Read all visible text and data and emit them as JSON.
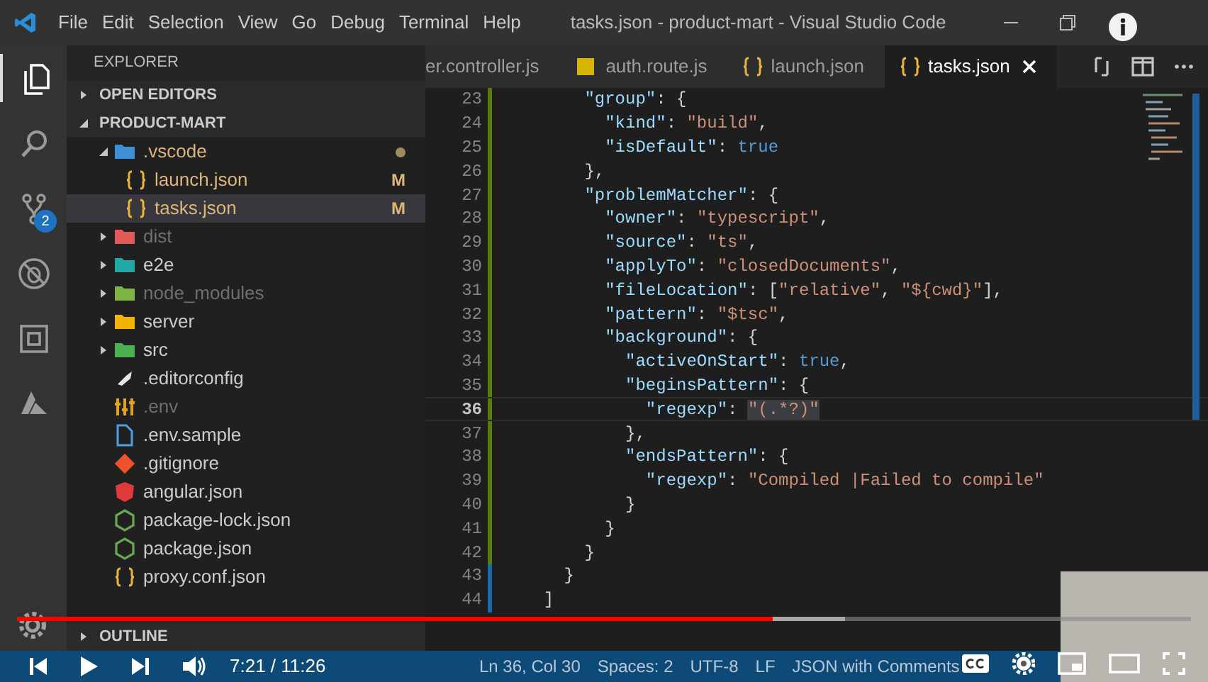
{
  "title_bar": {
    "menu": [
      "File",
      "Edit",
      "Selection",
      "View",
      "Go",
      "Debug",
      "Terminal",
      "Help"
    ],
    "title": "tasks.json - product-mart - Visual Studio Code"
  },
  "activity_bar": {
    "items": [
      {
        "kind": "files",
        "selected": true
      },
      {
        "kind": "search",
        "selected": false
      },
      {
        "kind": "source-control",
        "selected": false,
        "badge": "2"
      },
      {
        "kind": "debug",
        "selected": false
      },
      {
        "kind": "extensions",
        "selected": false
      },
      {
        "kind": "azure",
        "selected": false
      }
    ]
  },
  "sidebar": {
    "title": "EXPLORER",
    "sections": [
      {
        "label": "OPEN EDITORS",
        "expanded": false
      },
      {
        "label": "PRODUCT-MART",
        "expanded": true,
        "children": [
          {
            "name": ".vscode",
            "kind": "folder",
            "color": "#3d8fd6",
            "expanded": true,
            "selected": false,
            "ignored": false,
            "modified": true,
            "children": [
              {
                "name": "launch.json",
                "kind": "json",
                "selected": false,
                "ignored": false,
                "git": "M"
              },
              {
                "name": "tasks.json",
                "kind": "json",
                "selected": true,
                "ignored": false,
                "git": "M"
              }
            ]
          },
          {
            "name": "dist",
            "kind": "folder",
            "color": "#e05a5a",
            "expanded": false,
            "selected": false,
            "ignored": true,
            "modified": false
          },
          {
            "name": "e2e",
            "kind": "folder",
            "color": "#23a8a8",
            "expanded": false,
            "selected": false,
            "ignored": false,
            "modified": false
          },
          {
            "name": "node_modules",
            "kind": "folder",
            "color": "#7cb342",
            "expanded": false,
            "selected": false,
            "ignored": true,
            "modified": false
          },
          {
            "name": "server",
            "kind": "folder",
            "color": "#f2b400",
            "expanded": false,
            "selected": false,
            "ignored": false,
            "modified": false
          },
          {
            "name": "src",
            "kind": "folder",
            "color": "#4caf50",
            "expanded": false,
            "selected": false,
            "ignored": false,
            "modified": false
          },
          {
            "name": ".editorconfig",
            "kind": "editorconfig",
            "selected": false,
            "ignored": false
          },
          {
            "name": ".env",
            "kind": "env",
            "selected": false,
            "ignored": true
          },
          {
            "name": ".env.sample",
            "kind": "file",
            "selected": false,
            "ignored": false
          },
          {
            "name": ".gitignore",
            "kind": "git",
            "selected": false,
            "ignored": false
          },
          {
            "name": "angular.json",
            "kind": "angular",
            "selected": false,
            "ignored": false
          },
          {
            "name": "package-lock.json",
            "kind": "node",
            "selected": false,
            "ignored": false
          },
          {
            "name": "package.json",
            "kind": "node",
            "selected": false,
            "ignored": false
          },
          {
            "name": "proxy.conf.json",
            "kind": "json",
            "selected": false,
            "ignored": false
          }
        ]
      },
      {
        "label": "OUTLINE",
        "expanded": false
      }
    ]
  },
  "editor": {
    "tabs": [
      {
        "label": "er.controller.js",
        "selected": false
      },
      {
        "label": "auth.route.js",
        "kind": "js",
        "selected": false
      },
      {
        "label": "launch.json",
        "kind": "json",
        "selected": false
      },
      {
        "label": "tasks.json",
        "kind": "json",
        "selected": true
      }
    ],
    "lines": [
      {
        "number": "23",
        "current": false,
        "tokens": [
          {
            "kind": "key",
            "text": "      \"group\""
          },
          {
            "kind": "punct",
            "text": ": {"
          }
        ]
      },
      {
        "number": "24",
        "current": false,
        "tokens": [
          {
            "kind": "key",
            "text": "        \"kind\""
          },
          {
            "kind": "punct",
            "text": ": "
          },
          {
            "kind": "string",
            "text": "\"build\""
          },
          {
            "kind": "punct",
            "text": ","
          }
        ]
      },
      {
        "number": "25",
        "current": false,
        "tokens": [
          {
            "kind": "key",
            "text": "        \"isDefault\""
          },
          {
            "kind": "punct",
            "text": ": "
          },
          {
            "kind": "keyword",
            "text": "true"
          }
        ]
      },
      {
        "number": "26",
        "current": false,
        "tokens": [
          {
            "kind": "punct",
            "text": "      },"
          }
        ]
      },
      {
        "number": "27",
        "current": false,
        "tokens": [
          {
            "kind": "key",
            "text": "      \"problemMatcher\""
          },
          {
            "kind": "punct",
            "text": ": {"
          }
        ]
      },
      {
        "number": "28",
        "current": false,
        "tokens": [
          {
            "kind": "key",
            "text": "        \"owner\""
          },
          {
            "kind": "punct",
            "text": ": "
          },
          {
            "kind": "string",
            "text": "\"typescript\""
          },
          {
            "kind": "punct",
            "text": ","
          }
        ]
      },
      {
        "number": "29",
        "current": false,
        "tokens": [
          {
            "kind": "key",
            "text": "        \"source\""
          },
          {
            "kind": "punct",
            "text": ": "
          },
          {
            "kind": "string",
            "text": "\"ts\""
          },
          {
            "kind": "punct",
            "text": ","
          }
        ]
      },
      {
        "number": "30",
        "current": false,
        "tokens": [
          {
            "kind": "key",
            "text": "        \"applyTo\""
          },
          {
            "kind": "punct",
            "text": ": "
          },
          {
            "kind": "string",
            "text": "\"closedDocuments\""
          },
          {
            "kind": "punct",
            "text": ","
          }
        ]
      },
      {
        "number": "31",
        "current": false,
        "tokens": [
          {
            "kind": "key",
            "text": "        \"fileLocation\""
          },
          {
            "kind": "punct",
            "text": ": ["
          },
          {
            "kind": "string",
            "text": "\"relative\""
          },
          {
            "kind": "punct",
            "text": ", "
          },
          {
            "kind": "string",
            "text": "\"${cwd}\""
          },
          {
            "kind": "punct",
            "text": "],"
          }
        ]
      },
      {
        "number": "32",
        "current": false,
        "tokens": [
          {
            "kind": "key",
            "text": "        \"pattern\""
          },
          {
            "kind": "punct",
            "text": ": "
          },
          {
            "kind": "string",
            "text": "\"$tsc\""
          },
          {
            "kind": "punct",
            "text": ","
          }
        ]
      },
      {
        "number": "33",
        "current": false,
        "tokens": [
          {
            "kind": "key",
            "text": "        \"background\""
          },
          {
            "kind": "punct",
            "text": ": {"
          }
        ]
      },
      {
        "number": "34",
        "current": false,
        "tokens": [
          {
            "kind": "key",
            "text": "          \"activeOnStart\""
          },
          {
            "kind": "punct",
            "text": ": "
          },
          {
            "kind": "keyword",
            "text": "true"
          },
          {
            "kind": "punct",
            "text": ","
          }
        ]
      },
      {
        "number": "35",
        "current": false,
        "tokens": [
          {
            "kind": "key",
            "text": "          \"beginsPattern\""
          },
          {
            "kind": "punct",
            "text": ": {"
          }
        ]
      },
      {
        "number": "36",
        "current": true,
        "tokens": [
          {
            "kind": "key",
            "text": "            \"regexp\""
          },
          {
            "kind": "punct",
            "text": ": "
          },
          {
            "kind": "selection",
            "text": "\"(.*?)\""
          }
        ]
      },
      {
        "number": "37",
        "current": false,
        "tokens": [
          {
            "kind": "punct",
            "text": "          },"
          }
        ]
      },
      {
        "number": "38",
        "current": false,
        "tokens": [
          {
            "kind": "key",
            "text": "          \"endsPattern\""
          },
          {
            "kind": "punct",
            "text": ": {"
          }
        ]
      },
      {
        "number": "39",
        "current": false,
        "tokens": [
          {
            "kind": "key",
            "text": "            \"regexp\""
          },
          {
            "kind": "punct",
            "text": ": "
          },
          {
            "kind": "string",
            "text": "\"Compiled |Failed to compile\""
          }
        ]
      },
      {
        "number": "40",
        "current": false,
        "tokens": [
          {
            "kind": "punct",
            "text": "          }"
          }
        ]
      },
      {
        "number": "41",
        "current": false,
        "tokens": [
          {
            "kind": "punct",
            "text": "        }"
          }
        ]
      },
      {
        "number": "42",
        "current": false,
        "tokens": [
          {
            "kind": "punct",
            "text": "      }"
          }
        ]
      },
      {
        "number": "43",
        "current": false,
        "tokens": [
          {
            "kind": "punct",
            "text": "    }"
          }
        ]
      },
      {
        "number": "44",
        "current": false,
        "tokens": [
          {
            "kind": "punct",
            "text": "  ]"
          }
        ]
      }
    ]
  },
  "status_bar": {
    "items": [
      "Ln 36, Col 30",
      "Spaces: 2",
      "UTF-8",
      "LF",
      "JSON with Comments"
    ]
  },
  "player": {
    "time": "7:21 / 11:26",
    "level": 0.644,
    "buffer": {
      "level": 0.705
    }
  }
}
